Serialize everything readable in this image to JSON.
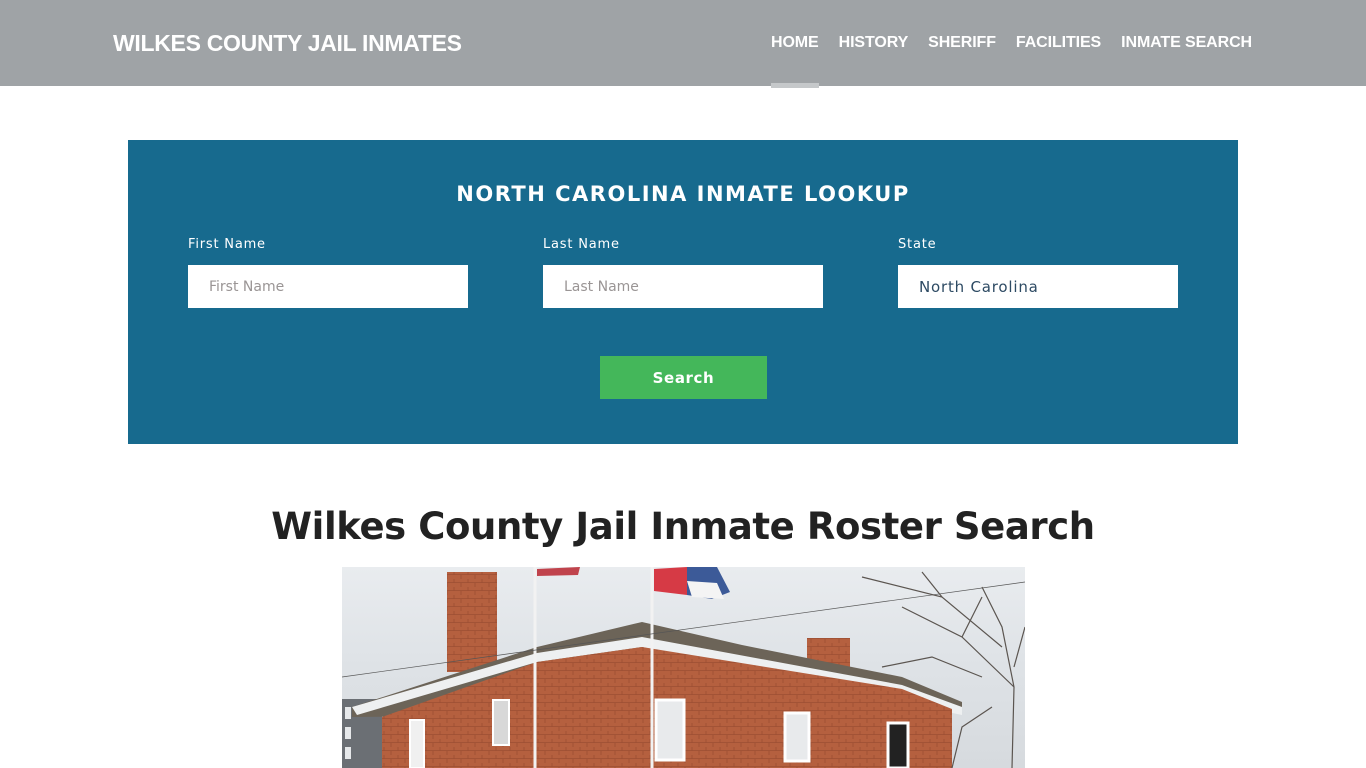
{
  "header": {
    "brand": "WILKES COUNTY JAIL INMATES",
    "nav": [
      {
        "label": "HOME",
        "active": true
      },
      {
        "label": "HISTORY",
        "active": false
      },
      {
        "label": "SHERIFF",
        "active": false
      },
      {
        "label": "FACILITIES",
        "active": false
      },
      {
        "label": "INMATE SEARCH",
        "active": false
      }
    ]
  },
  "lookup": {
    "title": "NORTH CAROLINA INMATE LOOKUP",
    "first_name": {
      "label": "First Name",
      "placeholder": "First Name",
      "value": ""
    },
    "last_name": {
      "label": "Last Name",
      "placeholder": "Last Name",
      "value": ""
    },
    "state": {
      "label": "State",
      "value": "North Carolina"
    },
    "search_label": "Search"
  },
  "content": {
    "title": "Wilkes County Jail Inmate Roster Search",
    "photo_alt": "Wilkes County historic brick jail building with flags"
  },
  "colors": {
    "header_bg": "#9fa3a6",
    "panel_bg": "#176a8e",
    "button_bg": "#44b75a"
  }
}
